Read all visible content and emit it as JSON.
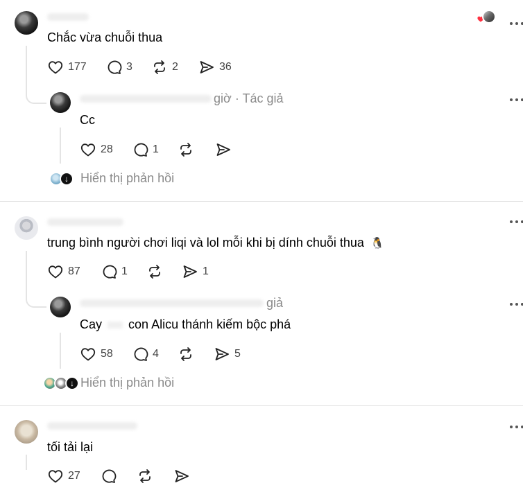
{
  "thread1": {
    "main_text": "Chắc vừa chuỗi thua",
    "counts": {
      "likes": "177",
      "replies": "3",
      "reposts": "2",
      "shares": "36"
    },
    "reply": {
      "meta_suffix": "giờ · Tác giả",
      "text": "Cc",
      "counts": {
        "likes": "28",
        "replies": "1",
        "reposts": "",
        "shares": ""
      }
    },
    "view_replies": "Hiển thị phản hồi"
  },
  "thread2": {
    "main_text": "trung bình người chơi liqi và lol mỗi khi bị dính chuỗi thua",
    "emoji": "🐧",
    "counts": {
      "likes": "87",
      "replies": "1",
      "reposts": "",
      "shares": "1"
    },
    "reply": {
      "meta_suffix": "giả",
      "text_pre": "Cay",
      "text_post": "con Alicu thánh kiếm bộc phá",
      "counts": {
        "likes": "58",
        "replies": "4",
        "reposts": "",
        "shares": "5"
      }
    },
    "view_replies": "Hiển thị phản hồi"
  },
  "thread3": {
    "main_text": "tối tải lại",
    "counts": {
      "likes": "27",
      "replies": "",
      "reposts": "",
      "shares": ""
    }
  },
  "icons": [
    "heart-icon",
    "comment-icon",
    "repost-icon",
    "share-icon",
    "more-icon"
  ],
  "colors": {
    "text": "#000000",
    "secondary": "#8a8a8a",
    "divider": "#e0e0e0",
    "heart_badge": "#ff3040"
  }
}
